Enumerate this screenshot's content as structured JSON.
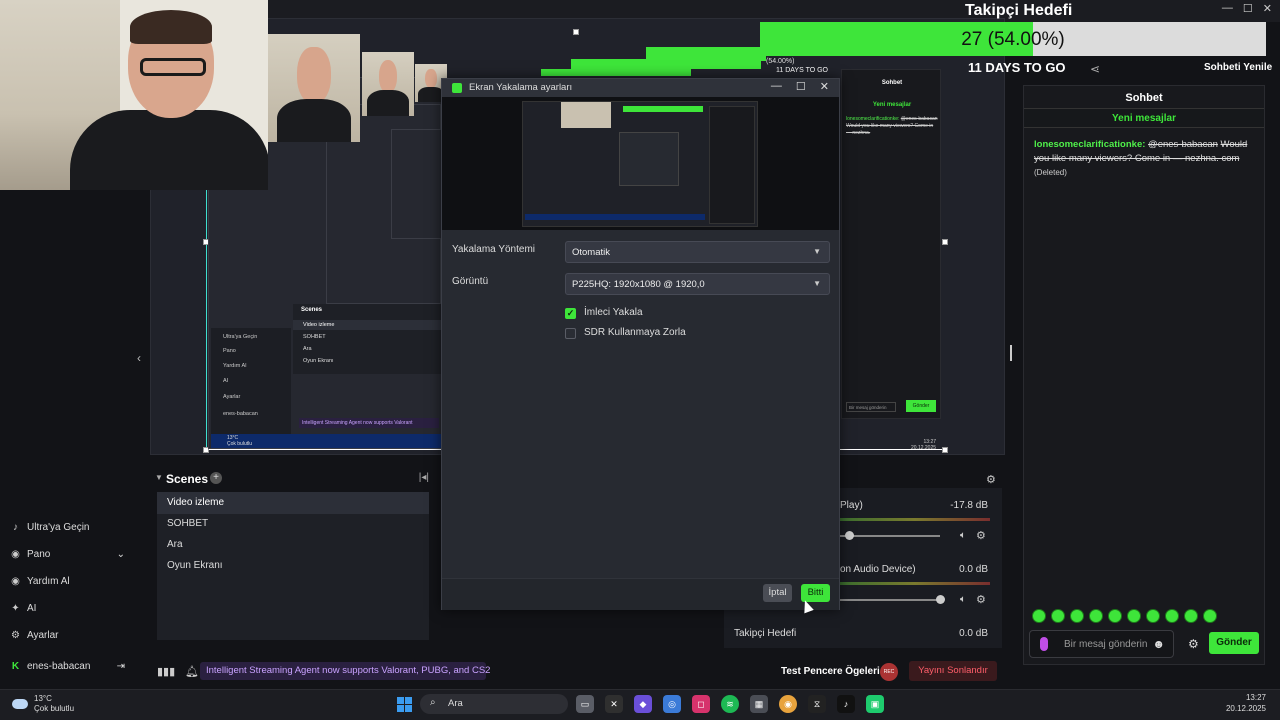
{
  "window_controls": [
    "—",
    "☐",
    "✕"
  ],
  "goal": {
    "title": "Takipçi Hedefi",
    "value_text": "27 (54.00%)",
    "progress": 0.54,
    "days_left": "11 DAYS TO GO",
    "chat_header_label": "Sohbeti Yenile"
  },
  "chat": {
    "title": "Sohbet",
    "new_messages": "Yeni mesajlar",
    "message": {
      "user": "lonesomeclarificationke:",
      "mention": "@enes-babacan",
      "text": "Would you like many viewers? Come in — nezhna. com",
      "tag": "(Deleted)"
    },
    "input_placeholder": "Bir mesaj gönderin",
    "send_label": "Gönder",
    "emote_count": 10
  },
  "left_nav": {
    "items": [
      {
        "icon": "ultra-icon",
        "label": "Ultra'ya Geçin"
      },
      {
        "icon": "dashboard-icon",
        "label": "Pano",
        "chevron": "⌄"
      },
      {
        "icon": "help-icon",
        "label": "Yardım Al"
      },
      {
        "icon": "ai-icon",
        "label": "AI"
      },
      {
        "icon": "settings-icon",
        "label": "Ayarlar"
      }
    ],
    "user": "enes-babacan"
  },
  "scenes": {
    "title": "Scenes",
    "items": [
      "Video izleme",
      "SOHBET",
      "Ara",
      "Oyun Ekranı"
    ],
    "selected": 0
  },
  "audio": {
    "items": [
      {
        "name": "Play)",
        "db": "-17.8 dB",
        "level": 0.18
      },
      {
        "name": "on Audio Device)",
        "db": "0.0 dB",
        "level": 0.96
      },
      {
        "name": "Takipçi Hedefi",
        "db": "0.0 dB"
      }
    ]
  },
  "status_bar": {
    "announcement": "Intelligent Streaming Agent now supports Valorant, PUBG, and CS2",
    "test_window": "Test Pencere Ögeleri",
    "rec_label": "REC",
    "end_stream": "Yayını Sonlandır"
  },
  "dialog": {
    "title": "Ekran Yakalama ayarları",
    "capture_method_label": "Yakalama Yöntemi",
    "capture_method_value": "Otomatik",
    "display_label": "Görüntü",
    "display_value": "P225HQ: 1920x1080 @ 1920,0",
    "capture_cursor_label": "İmleci Yakala",
    "capture_cursor_checked": true,
    "force_sdr_label": "SDR Kullanmaya Zorla",
    "force_sdr_checked": false,
    "cancel_label": "İptal",
    "done_label": "Bitti"
  },
  "nested_preview": {
    "scenes_title": "Scenes",
    "scenes": [
      "Video izleme",
      "SOHBET",
      "Ara",
      "Oyun Ekranı"
    ],
    "nav": [
      "Ultra'ya Geçin",
      "Pano",
      "Yardım Al",
      "AI",
      "Ayarlar",
      "enes-babacan"
    ],
    "announcement": "Intelligent Streaming Agent now supports Valorant",
    "chat_title": "Sohbet",
    "new_messages": "Yeni mesajlar",
    "message_user": "lonesomeclarificationke:",
    "message_text": "@enes-babacan Would you like many viewers? Come in — nezhna.",
    "input_placeholder": "Bir mesaj gönderin",
    "send": "Gönder",
    "goal_text": "27 (54.00%)",
    "days": "11 DAYS TO GO",
    "weather_temp": "13°C",
    "weather_desc": "Çok bulutlu",
    "time": "13:27",
    "date": "20.12.2025"
  },
  "taskbar": {
    "weather_temp": "13°C",
    "weather_desc": "Çok bulutlu",
    "search_label": "Ara",
    "time": "13:27",
    "date": "20.12.2025",
    "apps": [
      "file-explorer-icon",
      "xbox-icon",
      "m365-icon",
      "copilot-icon",
      "instagram-icon",
      "spotify-icon",
      "store-icon",
      "chrome-icon",
      "capcut-icon",
      "tiktok-icon",
      "streaming-app-icon"
    ]
  },
  "colors": {
    "accent": "#3ee53a",
    "danger": "#ff5e6a",
    "announce_bg": "#2a2040",
    "announce_text": "#c9a2ff"
  }
}
